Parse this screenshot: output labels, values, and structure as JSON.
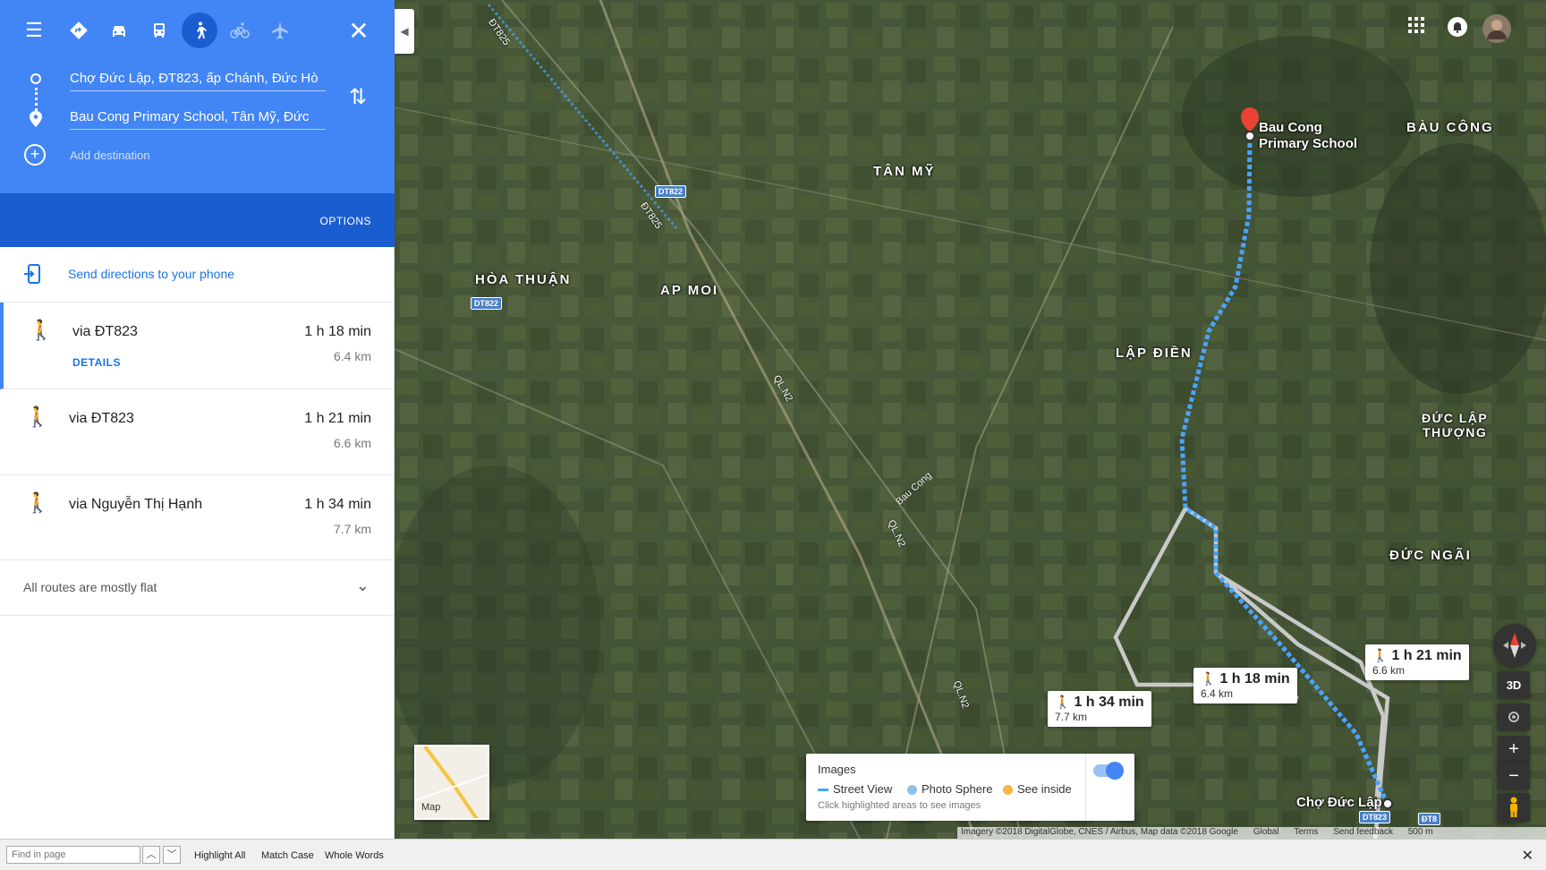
{
  "modes": [
    {
      "name": "directions-mode-best",
      "icon": "diamond-arrow-icon",
      "glyph": "◆"
    },
    {
      "name": "directions-mode-driving",
      "icon": "car-icon",
      "glyph": "🚗"
    },
    {
      "name": "directions-mode-transit",
      "icon": "bus-icon",
      "glyph": "🚌"
    },
    {
      "name": "directions-mode-walking",
      "icon": "walking-icon",
      "glyph": "🚶"
    },
    {
      "name": "directions-mode-cycling",
      "icon": "bicycle-icon",
      "glyph": "🚲"
    },
    {
      "name": "directions-mode-flights",
      "icon": "airplane-icon",
      "glyph": "✈"
    }
  ],
  "origin": "Chợ Đức Lập, ĐT823, ấp Chánh, Đức Hò",
  "destination": "Bau Cong Primary School, Tân Mỹ, Đức",
  "add_destination": "Add destination",
  "options_label": "OPTIONS",
  "send_to_phone": "Send directions to your phone",
  "routes": [
    {
      "via": "via ĐT823",
      "time": "1 h 18 min",
      "distance": "6.4 km",
      "details": "DETAILS"
    },
    {
      "via": "via ĐT823",
      "time": "1 h 21 min",
      "distance": "6.6 km"
    },
    {
      "via": "via Nguyễn Thị Hạnh",
      "time": "1 h 34 min",
      "distance": "7.7 km"
    }
  ],
  "flat_note": "All routes are mostly flat",
  "map": {
    "places": {
      "hoa_thuan": "HÒA THUẬN",
      "ap_moi": "AP MOI",
      "tan_my": "TÂN MỸ",
      "lap_dien": "LẬP ĐIỀN",
      "bau_cong": "BÀU CÔNG",
      "duc_lap_thuong_1": "ĐỨC LẬP",
      "duc_lap_thuong_2": "THƯỢNG",
      "duc_ngai": "ĐỨC NGÃI"
    },
    "roads": {
      "dt825_a": "ĐT825",
      "dt825_b": "ĐT825",
      "qln2_a": "QL.N2",
      "qln2_b": "QL.N2",
      "qln2_c": "QL.N2",
      "bau_cong_rd": "Bau Cong"
    },
    "shields": {
      "dt822_a": "DT822",
      "dt822_b": "DT822",
      "dt823": "DT823",
      "dt8": "ĐT8"
    },
    "destination_label_1": "Bau Cong",
    "destination_label_2": "Primary School",
    "origin_label": "Chợ Đức Lập",
    "bubbles": [
      {
        "time": "1 h 18 min",
        "distance": "6.4 km"
      },
      {
        "time": "1 h 21 min",
        "distance": "6.6 km"
      },
      {
        "time": "1 h 34 min",
        "distance": "7.7 km"
      }
    ],
    "imagery_panel": {
      "title": "Images",
      "street_view": "Street View",
      "photo_sphere": "Photo Sphere",
      "see_inside": "See inside",
      "note": "Click highlighted areas to see images"
    },
    "minimap_label": "Map",
    "btn_3d": "3D",
    "attribution": {
      "imagery": "Imagery ©2018 DigitalGlobe, CNES / Airbus, Map data ©2018 Google",
      "global": "Global",
      "terms": "Terms",
      "feedback": "Send feedback",
      "scale": "500 m"
    },
    "colors": {
      "route": "#4aa3ff",
      "alt_route": "#c9c9c9",
      "pin": "#ea4335",
      "accent": "#4285f4"
    }
  },
  "findbar": {
    "placeholder": "Find in page",
    "highlight_all": "Highlight All",
    "match_case": "Match Case",
    "whole_words": "Whole Words"
  }
}
